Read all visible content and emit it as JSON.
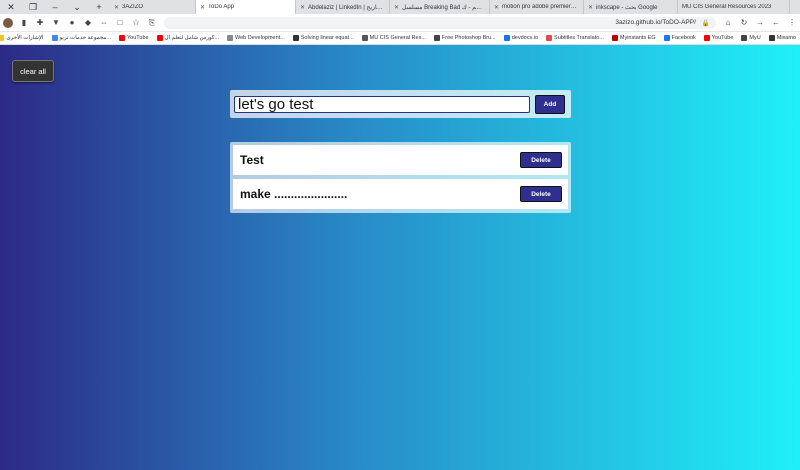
{
  "browser": {
    "tabs": [
      {
        "title": "3AZIZO",
        "color": "#444444",
        "active": false
      },
      {
        "title": "ToDo App",
        "color": "#444444",
        "active": true
      },
      {
        "title": "Abdelaziz | LinkedIn | الشهاريح",
        "color": "#0a66c2",
        "active": false
      },
      {
        "title": "مسلسل Breaking Bad مترجم - ك...",
        "color": "#d93025",
        "active": false
      },
      {
        "title": "motion pro adobe premiere - ...",
        "color": "#4285f4",
        "active": false
      },
      {
        "title": "inkscape - بحث Google",
        "color": "#4285f4",
        "active": false
      },
      {
        "title": "MU CIS General Resources 2023",
        "color": "#4285f4",
        "active": false
      }
    ],
    "url": "3azizo.github.io/ToDO-APP/",
    "bookmarks": [
      {
        "label": "الإشارات الأخرى",
        "color": "#f1c232"
      },
      {
        "label": "مجموعة خدمات تربو...",
        "color": "#4285f4"
      },
      {
        "label": "YouTube",
        "color": "#ff0000"
      },
      {
        "label": "كورس شامل لتعلم ال...",
        "color": "#ff0000"
      },
      {
        "label": "Web Development...",
        "color": "#888888"
      },
      {
        "label": "Solving linear equat...",
        "color": "#333333"
      },
      {
        "label": "MU CIS General Res...",
        "color": "#555555"
      },
      {
        "label": "Free Photoshop Bru...",
        "color": "#444444"
      },
      {
        "label": "devdocs.io",
        "color": "#1a73e8"
      },
      {
        "label": "Subtitles Translato...",
        "color": "#e04c4c"
      },
      {
        "label": "Myinstants EG",
        "color": "#c00000"
      },
      {
        "label": "Facebook",
        "color": "#1877f2"
      },
      {
        "label": "YouTube",
        "color": "#ff0000"
      },
      {
        "label": "MyU",
        "color": "#444444"
      },
      {
        "label": "Mixamo",
        "color": "#333333"
      }
    ]
  },
  "app": {
    "clear_all_label": "clear all",
    "input_value": "let's go test",
    "add_label": "Add",
    "delete_label": "Delete",
    "todos": [
      {
        "text": "Test"
      },
      {
        "text": "make ......................"
      }
    ]
  }
}
